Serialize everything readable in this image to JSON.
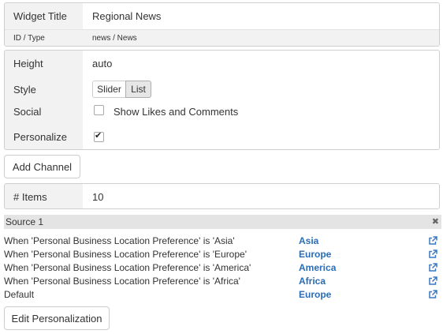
{
  "widget_info": {
    "title_label": "Widget Title",
    "title_value": "Regional News",
    "id_label": "ID / Type",
    "id_value": "news / News"
  },
  "settings": {
    "height_label": "Height",
    "height_value": "auto",
    "style_label": "Style",
    "style_options": [
      "Slider",
      "List"
    ],
    "style_selected": "List",
    "social_label": "Social",
    "social_checkbox_label": "Show Likes and Comments",
    "social_checked": false,
    "personalize_label": "Personalize",
    "personalize_checked": true,
    "personalize_checkmark": "✔"
  },
  "add_channel_label": "Add Channel",
  "items": {
    "label": "# Items",
    "value": "10"
  },
  "source": {
    "title": "Source 1",
    "close_glyph": "✖",
    "rules": [
      {
        "condition": "When 'Personal Business Location Preference' is 'Asia'",
        "target": "Asia"
      },
      {
        "condition": "When 'Personal Business Location Preference' is 'Europe'",
        "target": "Europe"
      },
      {
        "condition": "When 'Personal Business Location Preference' is 'America'",
        "target": "America"
      },
      {
        "condition": "When 'Personal Business Location Preference' is 'Africa'",
        "target": "Africa"
      },
      {
        "condition": "Default",
        "target": "Europe"
      }
    ]
  },
  "edit_personalization_label": "Edit Personalization",
  "colors": {
    "link": "#2a6db5",
    "label_background": "#f2f2f2",
    "border": "#cfcfcf",
    "icon": "#3a78c3"
  }
}
